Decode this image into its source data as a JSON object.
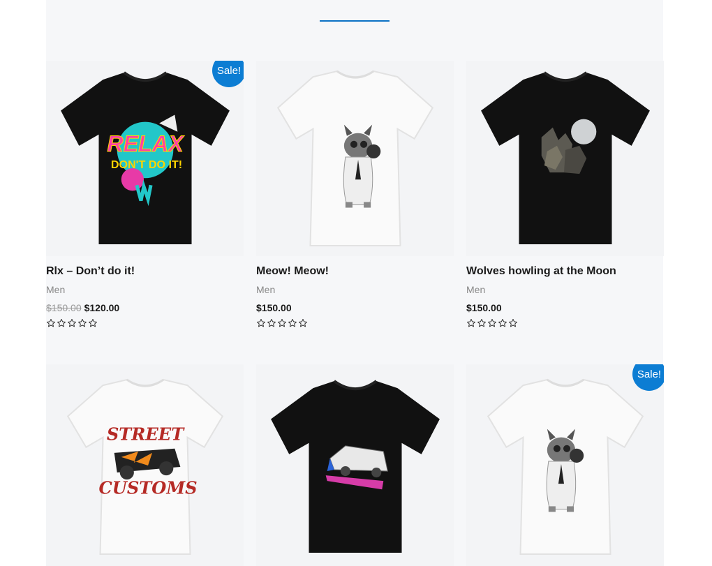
{
  "accent_color": "#0c72c5",
  "badge_color": "#0c7dd3",
  "products": [
    {
      "name": "Rlx – Don’t do it!",
      "category": "Men",
      "old_price": "$150.00",
      "price": "$120.00",
      "sale": true,
      "sale_label": "Sale!",
      "rating": 0,
      "rating_max": 5,
      "shirt_color": "black",
      "graphic": "relax-text-art"
    },
    {
      "name": "Meow! Meow!",
      "category": "Men",
      "old_price": "",
      "price": "$150.00",
      "sale": false,
      "sale_label": "",
      "rating": 0,
      "rating_max": 5,
      "shirt_color": "white",
      "graphic": "cat-with-glasses"
    },
    {
      "name": "Wolves howling at the Moon",
      "category": "Men",
      "old_price": "",
      "price": "$150.00",
      "sale": false,
      "sale_label": "",
      "rating": 0,
      "rating_max": 5,
      "shirt_color": "black",
      "graphic": "wolves-moon"
    },
    {
      "name": "",
      "category": "",
      "old_price": "",
      "price": "",
      "sale": false,
      "sale_label": "",
      "rating": 0,
      "rating_max": 5,
      "shirt_color": "white",
      "graphic": "street-customs-hotrod"
    },
    {
      "name": "",
      "category": "",
      "old_price": "",
      "price": "",
      "sale": false,
      "sale_label": "",
      "rating": 0,
      "rating_max": 5,
      "shirt_color": "black",
      "graphic": "retro-car"
    },
    {
      "name": "",
      "category": "",
      "old_price": "",
      "price": "",
      "sale": true,
      "sale_label": "Sale!",
      "rating": 0,
      "rating_max": 5,
      "shirt_color": "white",
      "graphic": "cat-with-glasses"
    }
  ]
}
